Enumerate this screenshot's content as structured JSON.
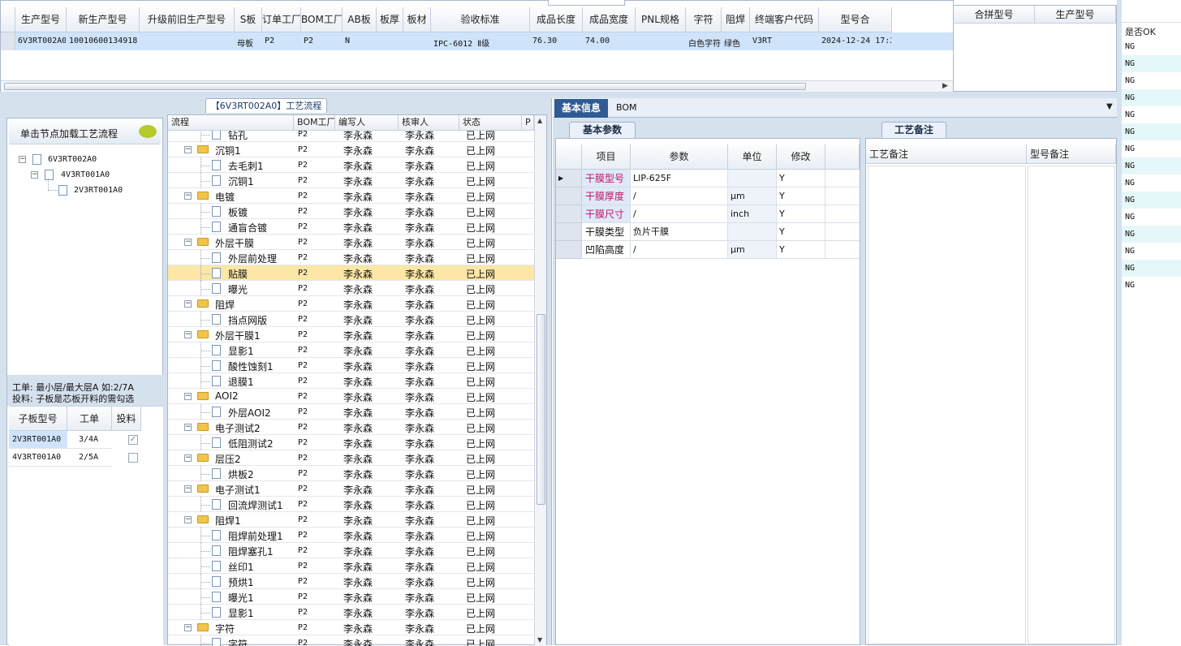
{
  "top_grid": {
    "headers": [
      "生产型号",
      "新生产型号",
      "升级前旧生产型号",
      "S板",
      "订单工厂",
      "BOM工厂",
      "AB板",
      "板厚",
      "板材",
      "验收标准",
      "成品长度",
      "成品宽度",
      "PNL规格",
      "字符",
      "阻焊",
      "终端客户代码",
      "型号合"
    ],
    "row": [
      "6V3RT002A0",
      "10010600134918",
      "",
      "母板",
      "P2",
      "P2",
      "N",
      "",
      "",
      "IPC-6012 Ⅱ级",
      "76.30",
      "74.00",
      "",
      "白色字符",
      "绿色",
      "V3RT",
      "2024-12-24 17:2"
    ]
  },
  "merge_grid": {
    "headers": [
      "合拼型号",
      "生产型号"
    ]
  },
  "ng_column": {
    "header": "是否OK",
    "values": [
      "NG",
      "NG",
      "NG",
      "NG",
      "NG",
      "NG",
      "NG",
      "NG",
      "NG",
      "NG",
      "NG",
      "NG",
      "NG",
      "NG",
      "NG"
    ]
  },
  "process_panel": {
    "title": "【6V3RT002A0】工艺流程"
  },
  "tree_panel": {
    "load_hint": "单击节点加载工艺流程",
    "nodes": [
      "6V3RT002A0",
      "4V3RT001A0",
      "2V3RT001A0"
    ],
    "note_line1": "工单: 最小层/最大层A 如:2/7A",
    "note_line2": "投料: 子板是芯板开料的需勾选",
    "sub_headers": [
      "子板型号",
      "工单",
      "投料"
    ],
    "sub_rows": [
      {
        "model": "2V3RT001A0",
        "order": "3/4A",
        "checked": true
      },
      {
        "model": "4V3RT001A0",
        "order": "2/5A",
        "checked": false
      }
    ]
  },
  "flow_grid": {
    "headers": [
      "流程",
      "BOM工厂",
      "编写人",
      "核审人",
      "状态",
      "P"
    ],
    "rows": [
      {
        "name": "钻孔",
        "level": 1,
        "factory": "P2",
        "writer": "李永森",
        "reviewer": "李永森",
        "status": "已上网"
      },
      {
        "name": "沉铜1",
        "level": 0,
        "factory": "P2",
        "writer": "李永森",
        "reviewer": "李永森",
        "status": "已上网"
      },
      {
        "name": "去毛刺1",
        "level": 1,
        "factory": "P2",
        "writer": "李永森",
        "reviewer": "李永森",
        "status": "已上网"
      },
      {
        "name": "沉铜1",
        "level": 1,
        "factory": "P2",
        "writer": "李永森",
        "reviewer": "李永森",
        "status": "已上网"
      },
      {
        "name": "电镀",
        "level": 0,
        "factory": "P2",
        "writer": "李永森",
        "reviewer": "李永森",
        "status": "已上网"
      },
      {
        "name": "板镀",
        "level": 1,
        "factory": "P2",
        "writer": "李永森",
        "reviewer": "李永森",
        "status": "已上网"
      },
      {
        "name": "通盲合镀",
        "level": 1,
        "factory": "P2",
        "writer": "李永森",
        "reviewer": "李永森",
        "status": "已上网"
      },
      {
        "name": "外层干膜",
        "level": 0,
        "factory": "P2",
        "writer": "李永森",
        "reviewer": "李永森",
        "status": "已上网"
      },
      {
        "name": "外层前处理",
        "level": 1,
        "factory": "P2",
        "writer": "李永森",
        "reviewer": "李永森",
        "status": "已上网"
      },
      {
        "name": "贴膜",
        "level": 1,
        "factory": "P2",
        "writer": "李永森",
        "reviewer": "李永森",
        "status": "已上网",
        "selected": true
      },
      {
        "name": "曝光",
        "level": 1,
        "factory": "P2",
        "writer": "李永森",
        "reviewer": "李永森",
        "status": "已上网"
      },
      {
        "name": "阻焊",
        "level": 0,
        "factory": "P2",
        "writer": "李永森",
        "reviewer": "李永森",
        "status": "已上网"
      },
      {
        "name": "挡点网版",
        "level": 1,
        "factory": "P2",
        "writer": "李永森",
        "reviewer": "李永森",
        "status": "已上网"
      },
      {
        "name": "外层干膜1",
        "level": 0,
        "factory": "P2",
        "writer": "李永森",
        "reviewer": "李永森",
        "status": "已上网"
      },
      {
        "name": "显影1",
        "level": 1,
        "factory": "P2",
        "writer": "李永森",
        "reviewer": "李永森",
        "status": "已上网"
      },
      {
        "name": "酸性蚀刻1",
        "level": 1,
        "factory": "P2",
        "writer": "李永森",
        "reviewer": "李永森",
        "status": "已上网"
      },
      {
        "name": "退膜1",
        "level": 1,
        "factory": "P2",
        "writer": "李永森",
        "reviewer": "李永森",
        "status": "已上网"
      },
      {
        "name": "AOI2",
        "level": 0,
        "factory": "P2",
        "writer": "李永森",
        "reviewer": "李永森",
        "status": "已上网"
      },
      {
        "name": "外层AOI2",
        "level": 1,
        "factory": "P2",
        "writer": "李永森",
        "reviewer": "李永森",
        "status": "已上网"
      },
      {
        "name": "电子测试2",
        "level": 0,
        "factory": "P2",
        "writer": "李永森",
        "reviewer": "李永森",
        "status": "已上网"
      },
      {
        "name": "低阻测试2",
        "level": 1,
        "factory": "P2",
        "writer": "李永森",
        "reviewer": "李永森",
        "status": "已上网"
      },
      {
        "name": "层压2",
        "level": 0,
        "factory": "P2",
        "writer": "李永森",
        "reviewer": "李永森",
        "status": "已上网"
      },
      {
        "name": "烘板2",
        "level": 1,
        "factory": "P2",
        "writer": "李永森",
        "reviewer": "李永森",
        "status": "已上网"
      },
      {
        "name": "电子测试1",
        "level": 0,
        "factory": "P2",
        "writer": "李永森",
        "reviewer": "李永森",
        "status": "已上网"
      },
      {
        "name": "回流焊测试1",
        "level": 1,
        "factory": "P2",
        "writer": "李永森",
        "reviewer": "李永森",
        "status": "已上网"
      },
      {
        "name": "阻焊1",
        "level": 0,
        "factory": "P2",
        "writer": "李永森",
        "reviewer": "李永森",
        "status": "已上网"
      },
      {
        "name": "阻焊前处理1",
        "level": 1,
        "factory": "P2",
        "writer": "李永森",
        "reviewer": "李永森",
        "status": "已上网"
      },
      {
        "name": "阻焊塞孔1",
        "level": 1,
        "factory": "P2",
        "writer": "李永森",
        "reviewer": "李永森",
        "status": "已上网"
      },
      {
        "name": "丝印1",
        "level": 1,
        "factory": "P2",
        "writer": "李永森",
        "reviewer": "李永森",
        "status": "已上网"
      },
      {
        "name": "预烘1",
        "level": 1,
        "factory": "P2",
        "writer": "李永森",
        "reviewer": "李永森",
        "status": "已上网"
      },
      {
        "name": "曝光1",
        "level": 1,
        "factory": "P2",
        "writer": "李永森",
        "reviewer": "李永森",
        "status": "已上网"
      },
      {
        "name": "显影1",
        "level": 1,
        "factory": "P2",
        "writer": "李永森",
        "reviewer": "李永森",
        "status": "已上网"
      },
      {
        "name": "字符",
        "level": 0,
        "factory": "P2",
        "writer": "李永森",
        "reviewer": "李永森",
        "status": "已上网"
      },
      {
        "name": "字符",
        "level": 1,
        "factory": "P2",
        "writer": "李永森",
        "reviewer": "李永森",
        "status": "已上网"
      }
    ]
  },
  "right_tabs": {
    "basic": "基本信息",
    "bom": "BOM"
  },
  "params": {
    "tab": "基本参数",
    "headers": [
      "项目",
      "参数",
      "单位",
      "修改"
    ],
    "rows": [
      {
        "item": "干膜型号",
        "value": "LIP-625F",
        "unit": "",
        "edit": "Y",
        "color": "#c0146c"
      },
      {
        "item": "干膜厚度",
        "value": "/",
        "unit": "μm",
        "edit": "Y",
        "color": "#c0146c"
      },
      {
        "item": "干膜尺寸",
        "value": "/",
        "unit": "inch",
        "edit": "Y",
        "color": "#c0146c"
      },
      {
        "item": "干膜类型",
        "value": "负片干膜",
        "unit": "",
        "edit": "Y",
        "color": "#111111"
      },
      {
        "item": "凹陷高度",
        "value": "/",
        "unit": "μm",
        "edit": "Y",
        "color": "#111111"
      }
    ]
  },
  "remarks": {
    "tab": "工艺备注",
    "col1": "工艺备注",
    "col2": "型号备注"
  },
  "colors": {
    "selection": "#cfe4fb",
    "highlight": "#fde7a6",
    "panel_bg": "#d6e1ee",
    "tab_active": "#2f5a94"
  }
}
